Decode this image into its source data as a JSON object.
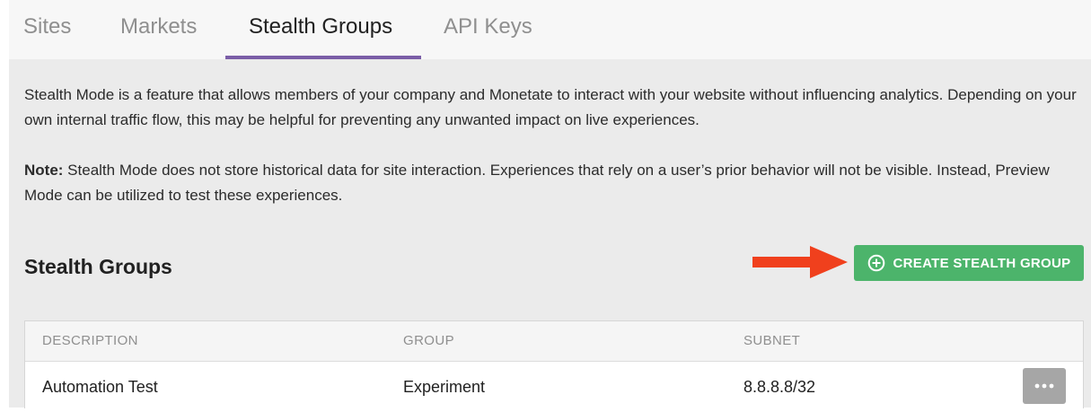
{
  "tabs": [
    {
      "label": "Sites",
      "active": false
    },
    {
      "label": "Markets",
      "active": false
    },
    {
      "label": "Stealth Groups",
      "active": true
    },
    {
      "label": "API Keys",
      "active": false
    }
  ],
  "colors": {
    "accent": "#7b5ea7",
    "button_green": "#4cb46b",
    "arrow_red": "#f0401d"
  },
  "intro": {
    "paragraph1": "Stealth Mode is a feature that allows members of your company and Monetate to interact with your website without influencing analytics. Depending on your own internal traffic flow, this may be helpful for preventing any unwanted impact on live experiences.",
    "note_label": "Note:",
    "note_text": " Stealth Mode does not store historical data for site interaction. Experiences that rely on a user’s prior behavior will not be visible. Instead, Preview Mode can be utilized to test these experiences."
  },
  "section": {
    "title": "Stealth Groups",
    "create_label": "CREATE STEALTH GROUP",
    "create_icon": "plus-circle-icon",
    "annotation_icon": "arrow-right-icon"
  },
  "table": {
    "headers": [
      "DESCRIPTION",
      "GROUP",
      "SUBNET"
    ],
    "rows": [
      {
        "description": "Automation Test",
        "group": "Experiment",
        "subnet": "8.8.8.8/32",
        "actions_icon": "more-icon"
      }
    ]
  }
}
